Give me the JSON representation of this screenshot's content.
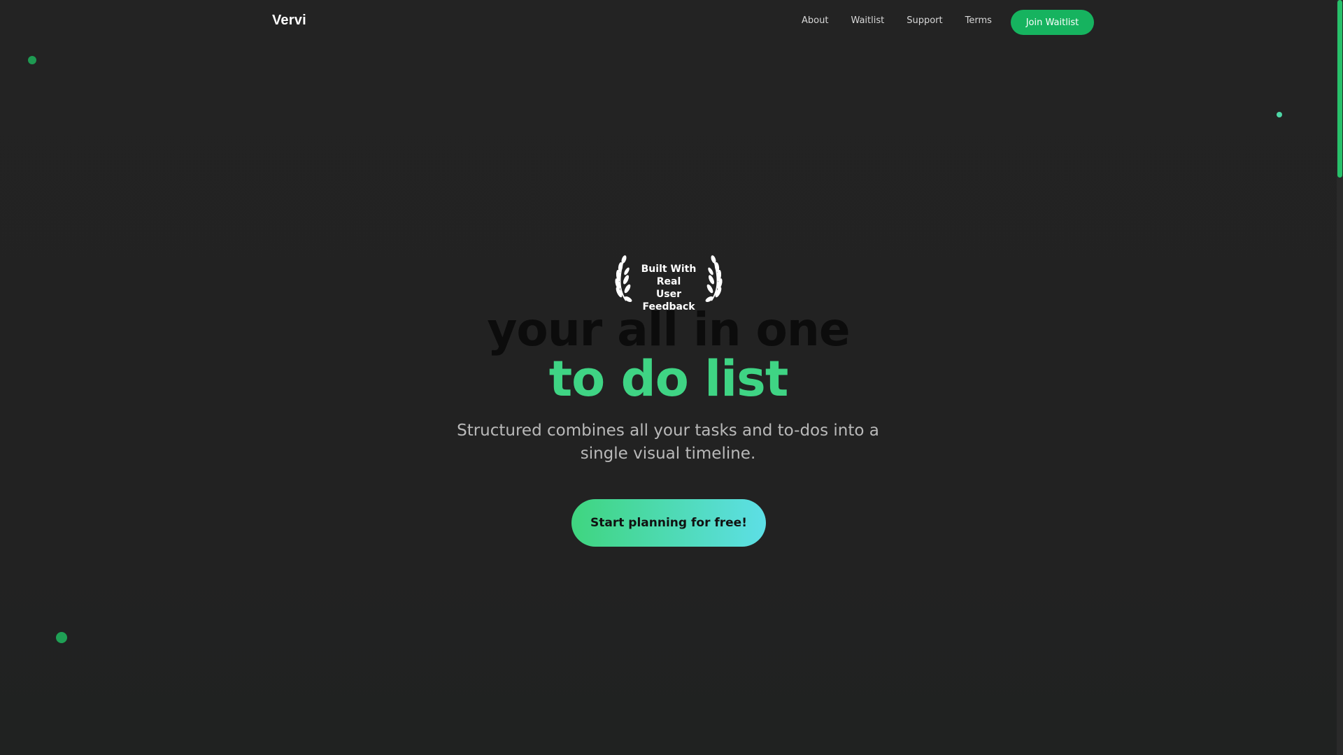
{
  "header": {
    "brand": "Vervi",
    "nav": [
      "About",
      "Waitlist",
      "Support",
      "Terms"
    ],
    "cta_label": "Join Waitlist"
  },
  "badge": {
    "line1": "Built With Real",
    "line2": "User Feedback",
    "icon": "laurel-wreath-icon"
  },
  "hero": {
    "headline_line1": "your all in one",
    "headline_line2": "to do list",
    "subtitle": "Structured combines all your tasks and to-dos into a single visual timeline.",
    "cta_label": "Start planning for free!"
  },
  "colors": {
    "background": "#232323",
    "accent_green": "#16b35f",
    "headline_green": "#3fd484",
    "cta_gradient_start": "#3fd57f",
    "cta_gradient_end": "#5ddfe6"
  }
}
